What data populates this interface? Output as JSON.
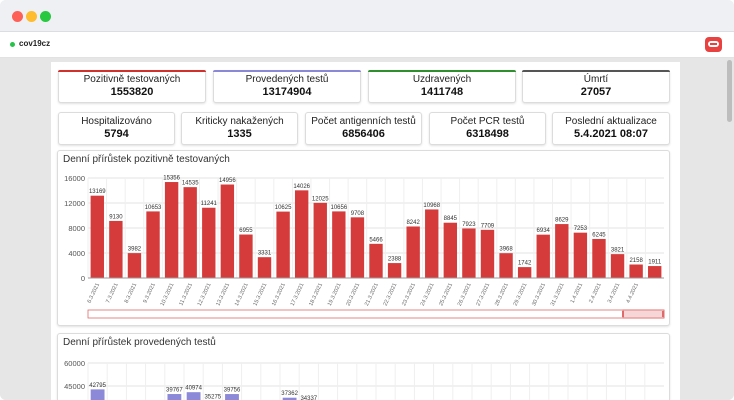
{
  "app": {
    "name": "cov19cz"
  },
  "stats_row1": [
    {
      "label": "Pozitivně testovaných",
      "value": "1553820",
      "accent": "#d0312d"
    },
    {
      "label": "Provedených testů",
      "value": "13174904",
      "accent": "#8c88d8"
    },
    {
      "label": "Uzdravených",
      "value": "1411748",
      "accent": "#2f8f2f"
    },
    {
      "label": "Úmrtí",
      "value": "27057",
      "accent": "#555555"
    }
  ],
  "stats_row2": [
    {
      "label": "Hospitalizováno",
      "value": "5794"
    },
    {
      "label": "Kriticky nakažených",
      "value": "1335"
    },
    {
      "label": "Počet antigenních testů",
      "value": "6856406"
    },
    {
      "label": "Počet PCR testů",
      "value": "6318498"
    },
    {
      "label": "Poslední aktualizace",
      "value": "5.4.2021 08:07"
    }
  ],
  "colors": {
    "positive_bar": "#d63b3b",
    "tests_bar": "#8d89d9",
    "zoom_border": "#e06a6a",
    "zoom_fill": "#f6d6d6"
  },
  "chart_data": [
    {
      "type": "bar",
      "title": "Denní přírůstek pozitivně testovaných",
      "categories": [
        "6.3.2021",
        "7.3.2021",
        "8.3.2021",
        "9.3.2021",
        "10.3.2021",
        "11.3.2021",
        "12.3.2021",
        "13.3.2021",
        "14.3.2021",
        "15.3.2021",
        "16.3.2021",
        "17.3.2021",
        "18.3.2021",
        "19.3.2021",
        "20.3.2021",
        "21.3.2021",
        "22.3.2021",
        "23.3.2021",
        "24.3.2021",
        "25.3.2021",
        "26.3.2021",
        "27.3.2021",
        "28.3.2021",
        "29.3.2021",
        "30.3.2021",
        "31.3.2021",
        "1.4.2021",
        "2.4.2021",
        "3.4.2021",
        "4.4.2021"
      ],
      "values": [
        13169,
        9130,
        3982,
        10653,
        15356,
        14535,
        11241,
        14956,
        6955,
        3331,
        10625,
        14026,
        12025,
        10656,
        9708,
        5466,
        2388,
        8242,
        10968,
        8845,
        7923,
        7709,
        3968,
        1742,
        6934,
        8629,
        7253,
        6245,
        3821,
        2158,
        1911
      ],
      "ylim": [
        0,
        16000
      ],
      "yticks": [
        "0",
        "4000",
        "8000",
        "12000",
        "16000"
      ],
      "grid": true
    },
    {
      "type": "bar",
      "title": "Denní přírůstek provedených testů",
      "ylim": [
        0,
        60000
      ],
      "yticks": [
        "45000",
        "60000"
      ],
      "visible_values": [
        "42795",
        "39767",
        "40974",
        "35275",
        "39756",
        "37362",
        "34337"
      ],
      "grid": true
    }
  ]
}
